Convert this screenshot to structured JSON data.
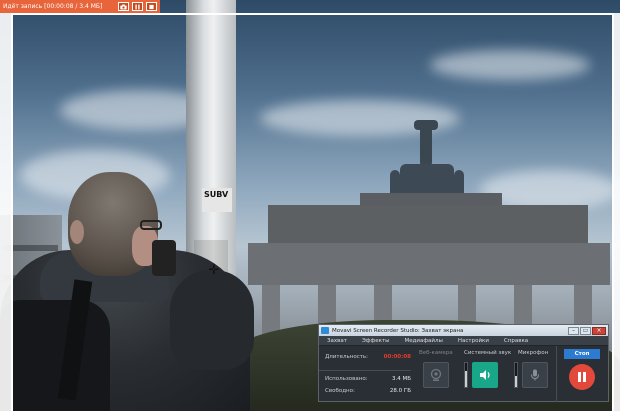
{
  "recording_bar": {
    "status": "Идёт запись [00:00:08 / 3.4 МБ]",
    "buttons": [
      {
        "name": "screenshot",
        "icon": "camera-icon"
      },
      {
        "name": "pause",
        "icon": "pause-icon"
      },
      {
        "name": "stop",
        "icon": "stop-icon"
      }
    ],
    "color": "#e8643a"
  },
  "background_photo": {
    "sign_text": "SUBV"
  },
  "recorder_window": {
    "title": "Movavi Screen Recorder Studio: Захват экрана",
    "window_buttons": [
      "–",
      "▭",
      "×"
    ],
    "menu": [
      "Захват",
      "Эффекты",
      "Медиафайлы",
      "Настройки",
      "Справка"
    ],
    "stats": {
      "duration_label": "Длительность:",
      "duration_value": "00:00:08",
      "used_label": "Использовано:",
      "used_value": "3.4 МБ",
      "free_label": "Свободно:",
      "free_value": "28.0 ГБ"
    },
    "sources": {
      "webcam_label": "Веб-камера",
      "system_sound_label": "Системный звук",
      "microphone_label": "Микрофон",
      "system_sound_level": 0.65,
      "microphone_level": 0.45
    },
    "stop_label": "Стоп",
    "accent_color": "#18a889",
    "stop_color": "#e2493a"
  }
}
